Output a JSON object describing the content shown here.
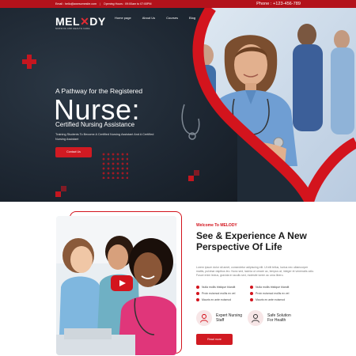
{
  "topbar": {
    "email": "Email : hello@awesomesite.com",
    "separator": "|",
    "hours": "Opening Hours : 09:00am to 07:00PM",
    "phone": "Phone : +123-456-789"
  },
  "brand": {
    "name_part1": "MEL",
    "name_mark": "✕",
    "name_part2": "DY",
    "tagline": "NURSING AND HEALTH CARE"
  },
  "nav": {
    "items": [
      "Home page",
      "About Us",
      "Courses",
      "Blog"
    ]
  },
  "hero": {
    "subheading": "A Pathway for the Registered",
    "heading": "Nurse:",
    "certification": "Certified Nursing Assistance",
    "description": "Training Students To Become A Certified Nursing Assistant And A Certified Nursing Assistant",
    "button_label": "Contact Us"
  },
  "about": {
    "eyebrow": "Welcome To MELODY",
    "title": "See & Experience A New Perspective Of Life",
    "body": "Lorem ipsum dolor sit amet, consectetur adipiscing elit. Ut elit tellus, luctus nec ullamcorper mattis, pulvinar dapibus leo. Nunc sed, lacinia ut ornare ac, tempus at, integer et venenatis odio. Fusce enim lectus, gravida in iaculis sed, molestie lorem ac urna libero.",
    "checklist": [
      "Nulla mollis tristique blandit",
      "Nulla mollis tristique blandit",
      "Proin euismod mollis ex vel",
      "Proin euismod mollis ex vel",
      "Mauris ex ante euismod",
      "Mauris ex ante euismod"
    ],
    "features": [
      {
        "label": "Expert Nursing Staff",
        "icon": "nurse-icon"
      },
      {
        "label": "Safe Solution For Health",
        "icon": "shield-heart-icon"
      }
    ],
    "button_label": "Read more"
  },
  "colors": {
    "accent": "#d3141d",
    "hero_bg": "#1f2a36",
    "topbar": "#b3121b"
  }
}
